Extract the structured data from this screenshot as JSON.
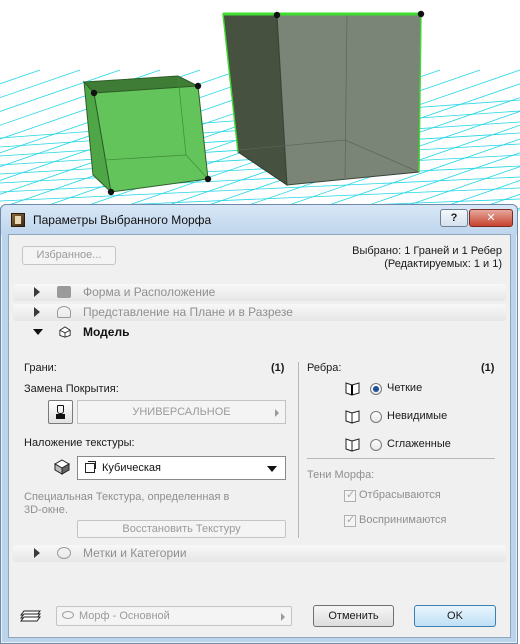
{
  "window": {
    "title": "Параметры Выбранного Морфа",
    "help_label": "?",
    "close_label": "✕"
  },
  "header": {
    "favorites_label": "Избранное...",
    "selected_text": "Выбрано: 1 Граней и 1 Ребер",
    "editable_text": "(Редактируемых: 1 и 1)"
  },
  "panels": {
    "shape": "Форма и Расположение",
    "plan": "Представление на Плане и в Разрезе",
    "model": "Модель",
    "tags": "Метки и Категории"
  },
  "model": {
    "faces_label": "Грани:",
    "faces_count": "(1)",
    "override_label": "Замена Покрытия:",
    "override_value": "УНИВЕРСАЛЬНОЕ",
    "texture_label": "Наложение текстуры:",
    "texture_value": "Кубическая",
    "texture_note_line1": "Специальная Текстура, определенная в",
    "texture_note_line2": "3D-окне.",
    "restore_label": "Восстановить Текстуру",
    "edges_label": "Ребра:",
    "edges_count": "(1)",
    "edge_options": [
      "Четкие",
      "Невидимые",
      "Сглаженные"
    ],
    "edge_selected": "Четкие",
    "shadows_label": "Тени Морфа:",
    "cast_label": "Отбрасываются",
    "cast_checked": true,
    "receive_label": "Воспринимаются",
    "receive_checked": true
  },
  "footer": {
    "layer_value": "Морф - Основной",
    "cancel_label": "Отменить",
    "ok_label": "OK"
  },
  "colors": {
    "grid": "#22d6e6",
    "cube_green": "#5bbf52",
    "cube_dark": "#4e5a4c",
    "dialog_frame": "#bcd4ea"
  },
  "icons": {
    "app": "morph-app-icon",
    "override": "paint-brush-icon",
    "texture": "texture-cube-icon",
    "edges": "edge-style-icon",
    "layer": "layers-icon"
  }
}
